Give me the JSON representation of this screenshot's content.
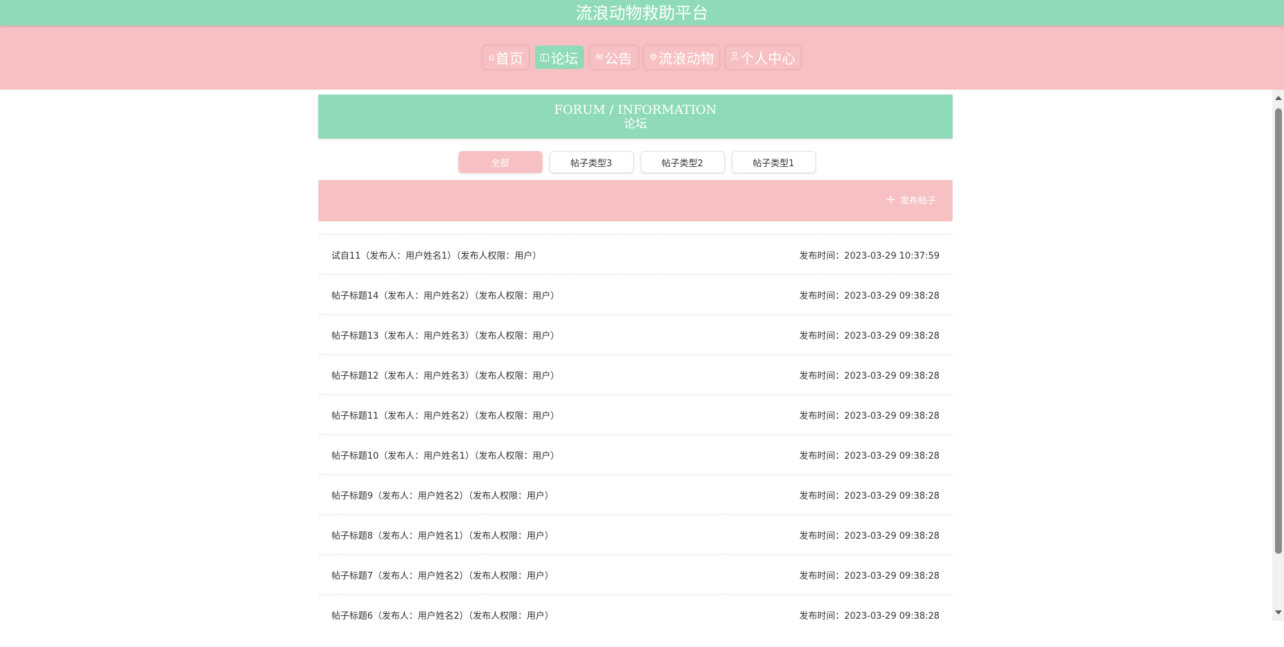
{
  "header": {
    "site_title": "流浪动物救助平台"
  },
  "nav": {
    "items": [
      {
        "label": "首页",
        "icon": "home-icon"
      },
      {
        "label": "论坛",
        "icon": "gift-icon",
        "active": true
      },
      {
        "label": "公告",
        "icon": "mail-icon"
      },
      {
        "label": "流浪动物",
        "icon": "settings-icon"
      },
      {
        "label": "个人中心",
        "icon": "user-icon"
      }
    ]
  },
  "page": {
    "title_en": "FORUM / INFORMATION",
    "title_cn": "论坛"
  },
  "categories": {
    "tabs": [
      {
        "label": "全部",
        "active": true
      },
      {
        "label": "帖子类型3"
      },
      {
        "label": "帖子类型2"
      },
      {
        "label": "帖子类型1"
      }
    ]
  },
  "actions": {
    "publish_label": "发布帖子",
    "publish_icon": "plus-icon"
  },
  "posts": [
    {
      "title": "试自11（发布人：用户姓名1）（发布人权限：用户）",
      "time": "发布时间：2023-03-29 10:37:59"
    },
    {
      "title": "帖子标题14（发布人：用户姓名2）（发布人权限：用户）",
      "time": "发布时间：2023-03-29 09:38:28"
    },
    {
      "title": "帖子标题13（发布人：用户姓名3）（发布人权限：用户）",
      "time": "发布时间：2023-03-29 09:38:28"
    },
    {
      "title": "帖子标题12（发布人：用户姓名3）（发布人权限：用户）",
      "time": "发布时间：2023-03-29 09:38:28"
    },
    {
      "title": "帖子标题11（发布人：用户姓名2）（发布人权限：用户）",
      "time": "发布时间：2023-03-29 09:38:28"
    },
    {
      "title": "帖子标题10（发布人：用户姓名1）（发布人权限：用户）",
      "time": "发布时间：2023-03-29 09:38:28"
    },
    {
      "title": "帖子标题9（发布人：用户姓名2）（发布人权限：用户）",
      "time": "发布时间：2023-03-29 09:38:28"
    },
    {
      "title": "帖子标题8（发布人：用户姓名1）（发布人权限：用户）",
      "time": "发布时间：2023-03-29 09:38:28"
    },
    {
      "title": "帖子标题7（发布人：用户姓名2）（发布人权限：用户）",
      "time": "发布时间：2023-03-29 09:38:28"
    },
    {
      "title": "帖子标题6（发布人：用户姓名2）（发布人权限：用户）",
      "time": "发布时间：2023-03-29 09:38:28"
    }
  ],
  "colors": {
    "mint": "#8fdbb8",
    "pink": "#f7c1c3",
    "text": "#333333"
  }
}
